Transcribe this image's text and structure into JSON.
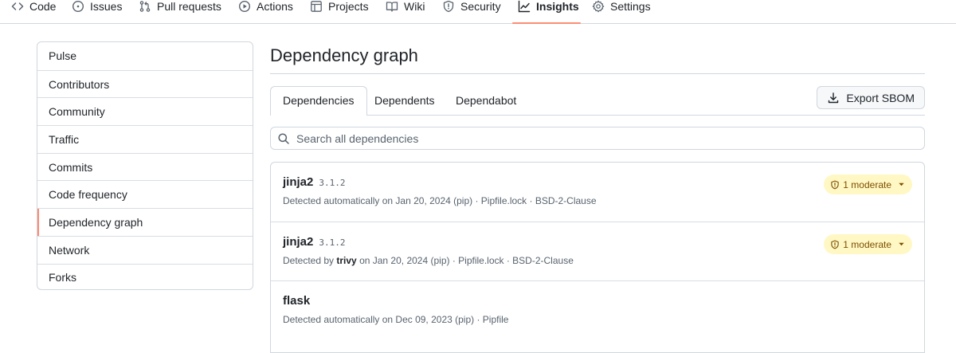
{
  "nav": {
    "tabs": [
      {
        "label": "Code",
        "icon": "code-icon"
      },
      {
        "label": "Issues",
        "icon": "issue-opened-icon"
      },
      {
        "label": "Pull requests",
        "icon": "git-pull-request-icon"
      },
      {
        "label": "Actions",
        "icon": "play-icon"
      },
      {
        "label": "Projects",
        "icon": "table-icon"
      },
      {
        "label": "Wiki",
        "icon": "book-icon"
      },
      {
        "label": "Security",
        "icon": "shield-icon"
      },
      {
        "label": "Insights",
        "icon": "graph-icon",
        "selected": true
      },
      {
        "label": "Settings",
        "icon": "gear-icon"
      }
    ],
    "accent": "#fd8c73"
  },
  "sidebar": {
    "items": [
      {
        "label": "Pulse"
      },
      {
        "label": "Contributors"
      },
      {
        "label": "Community"
      },
      {
        "label": "Traffic"
      },
      {
        "label": "Commits"
      },
      {
        "label": "Code frequency"
      },
      {
        "label": "Dependency graph",
        "selected": true
      },
      {
        "label": "Network"
      },
      {
        "label": "Forks"
      }
    ]
  },
  "main": {
    "title": "Dependency graph",
    "tabs": [
      {
        "label": "Dependencies",
        "selected": true
      },
      {
        "label": "Dependents"
      },
      {
        "label": "Dependabot"
      }
    ],
    "export_label": "Export SBOM",
    "search": {
      "placeholder": "Search all dependencies",
      "value": ""
    },
    "dependencies": [
      {
        "name": "jinja2",
        "version": "3.1.2",
        "meta_prefix": "Detected automatically on Jan 20, 2024 (pip) · Pipfile.lock · BSD-2-Clause",
        "detector": "",
        "meta_suffix": "",
        "alert": "1 moderate"
      },
      {
        "name": "jinja2",
        "version": "3.1.2",
        "meta_prefix": "Detected by ",
        "detector": "trivy",
        "meta_suffix": " on Jan 20, 2024 (pip) · Pipfile.lock · BSD-2-Clause",
        "alert": "1 moderate"
      },
      {
        "name": "flask",
        "version": "",
        "meta_prefix": "Detected automatically on Dec 09, 2023 (pip) · Pipfile",
        "detector": "",
        "meta_suffix": "",
        "alert": ""
      }
    ],
    "alert_color": "#fff8c5"
  }
}
